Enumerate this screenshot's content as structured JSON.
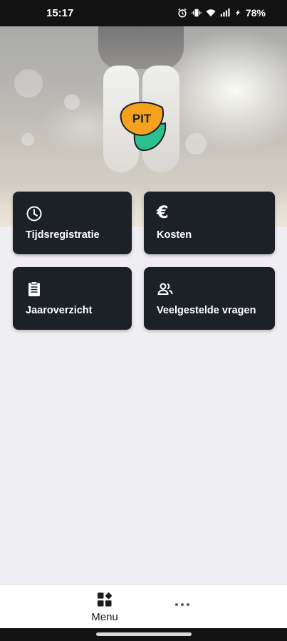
{
  "status_bar": {
    "time": "15:17",
    "battery": "78%",
    "icons": [
      "alarm-icon",
      "vibrate-icon",
      "wifi-icon",
      "signal-icon",
      "charging-icon"
    ]
  },
  "hero": {
    "logo_text": "PIT",
    "logo_colors": {
      "orange": "#f4a21c",
      "green": "#2cc08f",
      "outline": "#1c2023"
    }
  },
  "tiles": [
    {
      "label": "Tijdsregistratie",
      "icon": "clock-icon"
    },
    {
      "label": "Kosten",
      "icon": "euro-icon",
      "glyph": "€"
    },
    {
      "label": "Jaaroverzicht",
      "icon": "clipboard-icon"
    },
    {
      "label": "Veelgestelde vragen",
      "icon": "people-icon"
    }
  ],
  "bottom_nav": {
    "menu_label": "Menu",
    "menu_icon": "grid-menu-icon",
    "more_icon": "more-dots-icon"
  },
  "colors": {
    "tile_background": "#1c2128",
    "page_background": "#efeff3",
    "status_bar": "#121212"
  }
}
